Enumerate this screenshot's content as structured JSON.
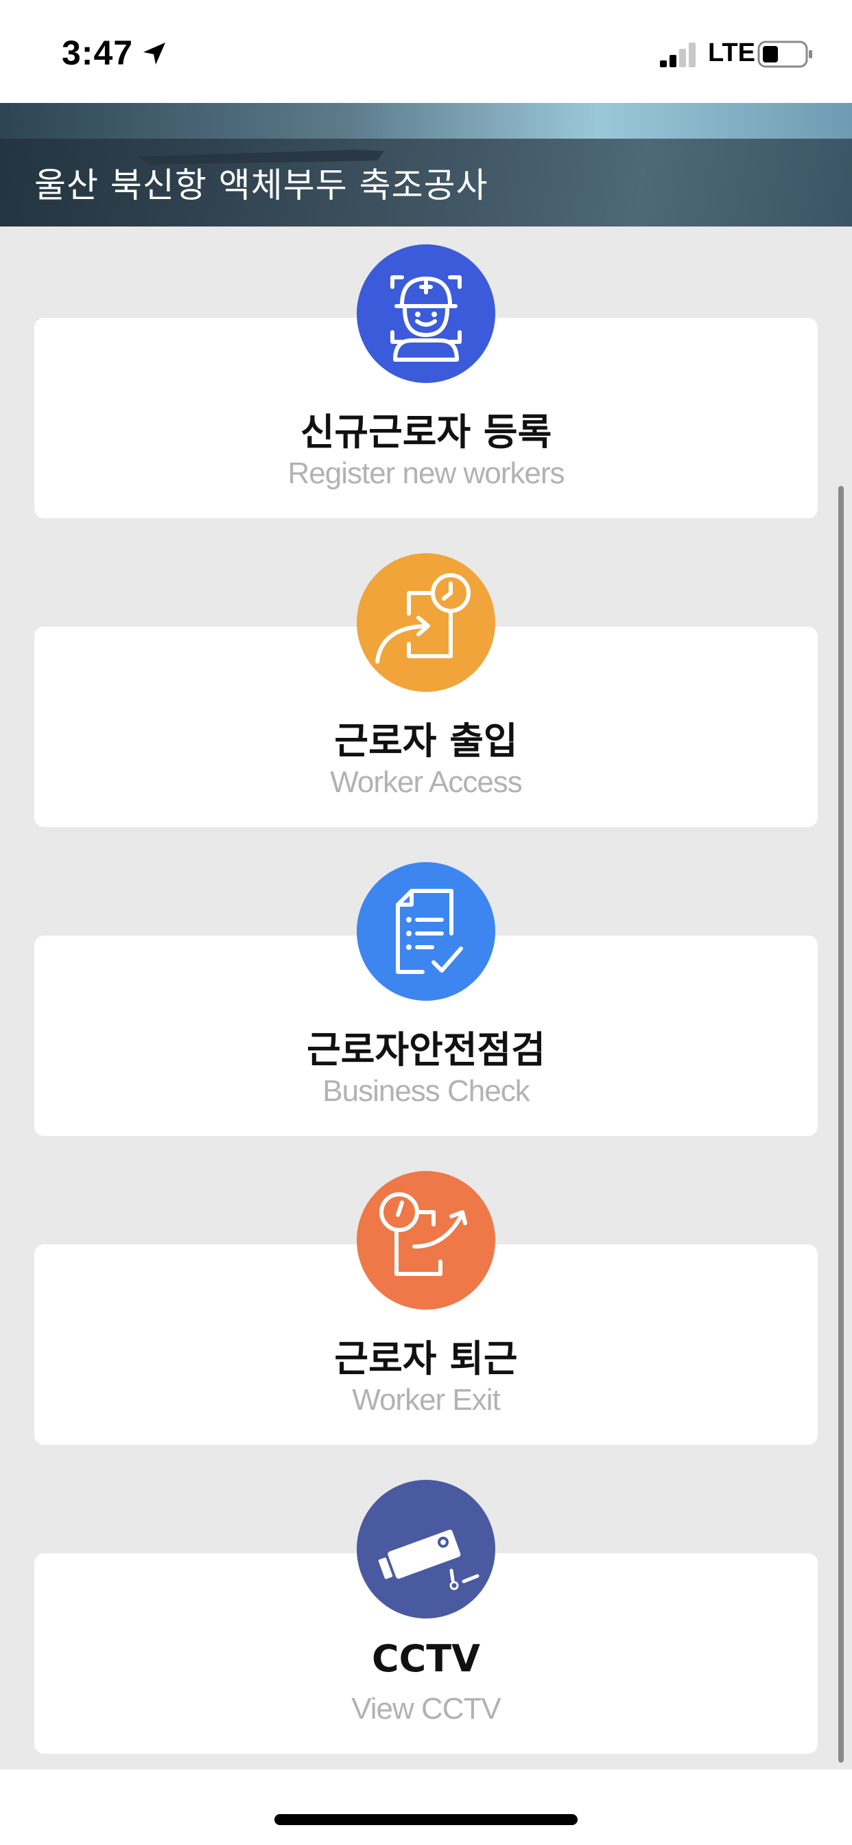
{
  "status_bar": {
    "time": "3:47",
    "network": "LTE",
    "icons": [
      "location-arrow-icon",
      "signal-icon",
      "battery-icon"
    ]
  },
  "header": {
    "title": "울산 북신항 액체부두 축조공사"
  },
  "menu": [
    {
      "title": "신규근로자 등록",
      "subtitle": "Register new workers",
      "icon": "worker-helmet-icon",
      "color": "#3b5bdb"
    },
    {
      "title": "근로자 출입",
      "subtitle": "Worker Access",
      "icon": "clock-entry-icon",
      "color": "#f0a43a"
    },
    {
      "title": "근로자안전점검",
      "subtitle": "Business Check",
      "icon": "checklist-document-icon",
      "color": "#3d86f0"
    },
    {
      "title": "근로자 퇴근",
      "subtitle": "Worker Exit",
      "icon": "clock-exit-icon",
      "color": "#ee7848"
    },
    {
      "title": "CCTV",
      "subtitle": "View CCTV",
      "icon": "cctv-camera-icon",
      "color": "#4a5aa0"
    }
  ]
}
